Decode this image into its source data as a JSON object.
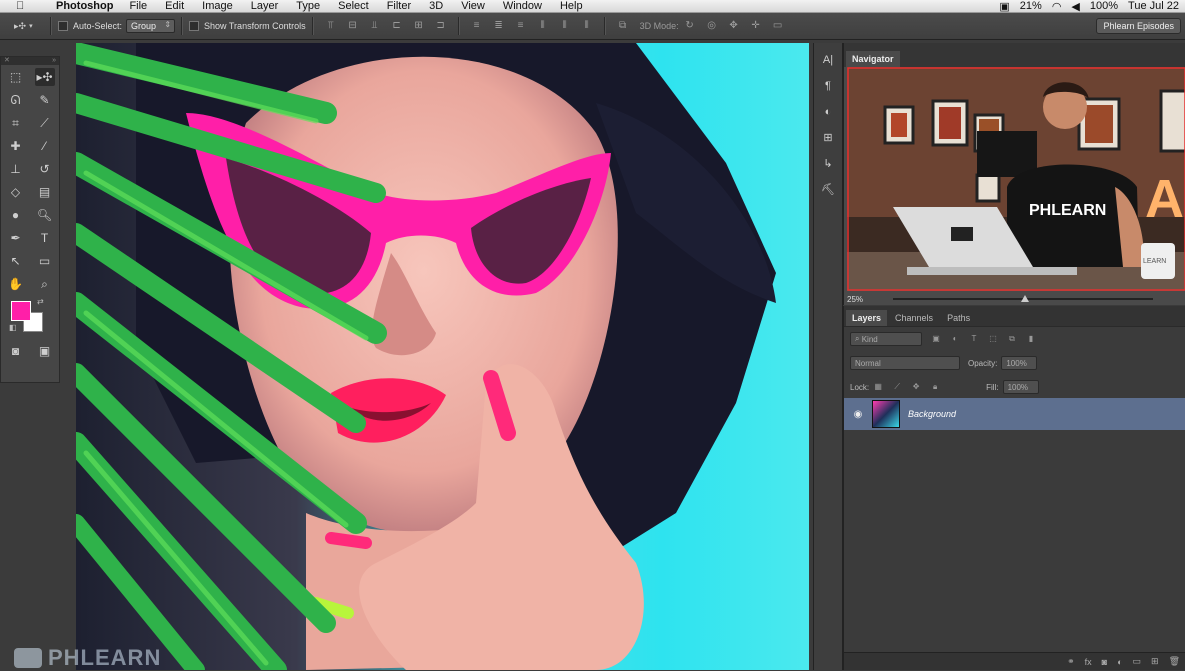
{
  "menubar": {
    "app": "Photoshop",
    "menus": [
      "File",
      "Edit",
      "Image",
      "Layer",
      "Type",
      "Select",
      "Filter",
      "3D",
      "View",
      "Window",
      "Help"
    ],
    "battery": "21%",
    "battery_full": "100%",
    "clock": "Tue Jul 22"
  },
  "options": {
    "auto_select_label": "Auto-Select:",
    "auto_select_value": "Group",
    "transform_label": "Show Transform Controls",
    "mode3d_label": "3D Mode:",
    "workspace": "Phlearn Episodes"
  },
  "navigator": {
    "tab": "Navigator",
    "zoom": "25%",
    "thumb_shirt": "PHLEARN",
    "thumb_mug": "LEARN",
    "thumb_sign": "A"
  },
  "layers": {
    "tabs": [
      "Layers",
      "Channels",
      "Paths"
    ],
    "filter_kind": "Kind",
    "blend_mode": "Normal",
    "opacity_label": "Opacity:",
    "opacity_value": "100%",
    "lock_label": "Lock:",
    "fill_label": "Fill:",
    "fill_value": "100%",
    "layer_name": "Background"
  },
  "watermark": "PHLEARN",
  "colors": {
    "foreground": "#ff1fa8",
    "background": "#ffffff",
    "selected_layer": "#5d6f8f"
  }
}
